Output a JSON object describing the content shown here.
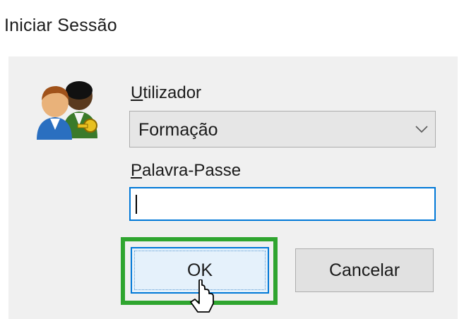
{
  "dialog": {
    "title": "Iniciar Sessão",
    "icon": "users-key-icon"
  },
  "user": {
    "label_access_key": "U",
    "label_rest": "tilizador",
    "selected_value": "Formação"
  },
  "password": {
    "label_access_key": "P",
    "label_rest": "alavra-Passe",
    "value": ""
  },
  "buttons": {
    "ok_label": "OK",
    "cancel_label": "Cancelar"
  },
  "colors": {
    "focus_blue": "#0078d7",
    "highlight_green": "#2fa52f"
  }
}
